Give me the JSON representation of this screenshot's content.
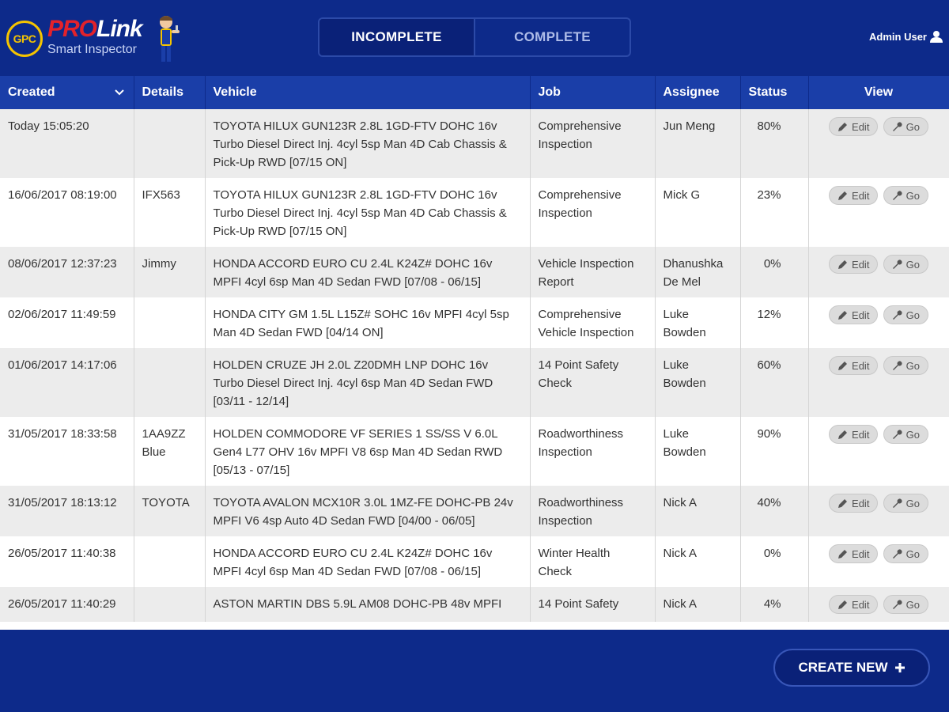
{
  "app": {
    "brand_badge": "GPC",
    "brand_pro": "PRO",
    "brand_link": "Link",
    "brand_sub": "Smart Inspector"
  },
  "tabs": {
    "incomplete": "INCOMPLETE",
    "complete": "COMPLETE",
    "active": "incomplete"
  },
  "user": {
    "name": "Admin User",
    "icon": "user-icon"
  },
  "table": {
    "headers": {
      "created": "Created",
      "details": "Details",
      "vehicle": "Vehicle",
      "job": "Job",
      "assignee": "Assignee",
      "status": "Status",
      "view": "View"
    },
    "edit_label": "Edit",
    "go_label": "Go",
    "rows": [
      {
        "created": "Today 15:05:20",
        "details": "",
        "vehicle": "TOYOTA HILUX GUN123R 2.8L 1GD-FTV DOHC 16v Turbo Diesel Direct Inj. 4cyl 5sp Man 4D Cab Chassis & Pick-Up RWD [07/15 ON]",
        "job": "Comprehensive Inspection",
        "assignee": "Jun Meng",
        "status": "80%"
      },
      {
        "created": "16/06/2017 08:19:00",
        "details": "IFX563",
        "vehicle": "TOYOTA HILUX GUN123R 2.8L 1GD-FTV DOHC 16v Turbo Diesel Direct Inj. 4cyl 5sp Man 4D Cab Chassis & Pick-Up RWD [07/15 ON]",
        "job": "Comprehensive Inspection",
        "assignee": "Mick G",
        "status": "23%"
      },
      {
        "created": "08/06/2017 12:37:23",
        "details": "Jimmy",
        "vehicle": "HONDA ACCORD EURO CU 2.4L K24Z# DOHC 16v MPFI 4cyl 6sp Man 4D Sedan FWD [07/08 - 06/15]",
        "job": "Vehicle Inspection Report",
        "assignee": "Dhanushka De Mel",
        "status": "0%"
      },
      {
        "created": "02/06/2017 11:49:59",
        "details": "",
        "vehicle": "HONDA CITY GM 1.5L L15Z# SOHC 16v MPFI 4cyl 5sp Man 4D Sedan FWD [04/14 ON]",
        "job": "Comprehensive Vehicle Inspection",
        "assignee": "Luke Bowden",
        "status": "12%"
      },
      {
        "created": "01/06/2017 14:17:06",
        "details": "",
        "vehicle": "HOLDEN CRUZE JH 2.0L Z20DMH LNP DOHC 16v Turbo Diesel Direct Inj. 4cyl 6sp Man 4D Sedan FWD [03/11 - 12/14]",
        "job": "14 Point Safety Check",
        "assignee": "Luke Bowden",
        "status": "60%"
      },
      {
        "created": "31/05/2017 18:33:58",
        "details": "1AA9ZZ Blue",
        "vehicle": "HOLDEN COMMODORE VF SERIES 1 SS/SS V 6.0L Gen4 L77 OHV 16v MPFI V8 6sp Man 4D Sedan RWD [05/13 - 07/15]",
        "job": "Roadworthiness Inspection",
        "assignee": "Luke Bowden",
        "status": "90%"
      },
      {
        "created": "31/05/2017 18:13:12",
        "details": "TOYOTA",
        "vehicle": "TOYOTA AVALON MCX10R 3.0L 1MZ-FE DOHC-PB 24v MPFI V6 4sp Auto 4D Sedan FWD [04/00 - 06/05]",
        "job": "Roadworthiness Inspection",
        "assignee": "Nick A",
        "status": "40%"
      },
      {
        "created": "26/05/2017 11:40:38",
        "details": "",
        "vehicle": "HONDA ACCORD EURO CU 2.4L K24Z# DOHC 16v MPFI 4cyl 6sp Man 4D Sedan FWD [07/08 - 06/15]",
        "job": "Winter Health Check",
        "assignee": "Nick A",
        "status": "0%"
      },
      {
        "created": "26/05/2017 11:40:29",
        "details": "",
        "vehicle": "ASTON MARTIN DBS 5.9L AM08 DOHC-PB 48v MPFI",
        "job": "14 Point Safety",
        "assignee": "Nick A",
        "status": "4%"
      }
    ]
  },
  "footer": {
    "create_label": "CREATE NEW",
    "create_icon": "plus-icon"
  },
  "colors": {
    "background": "#0d2a8a",
    "header_row": "#1a3ea8",
    "brand_red": "#e3222b",
    "badge_yellow": "#f5c400"
  }
}
